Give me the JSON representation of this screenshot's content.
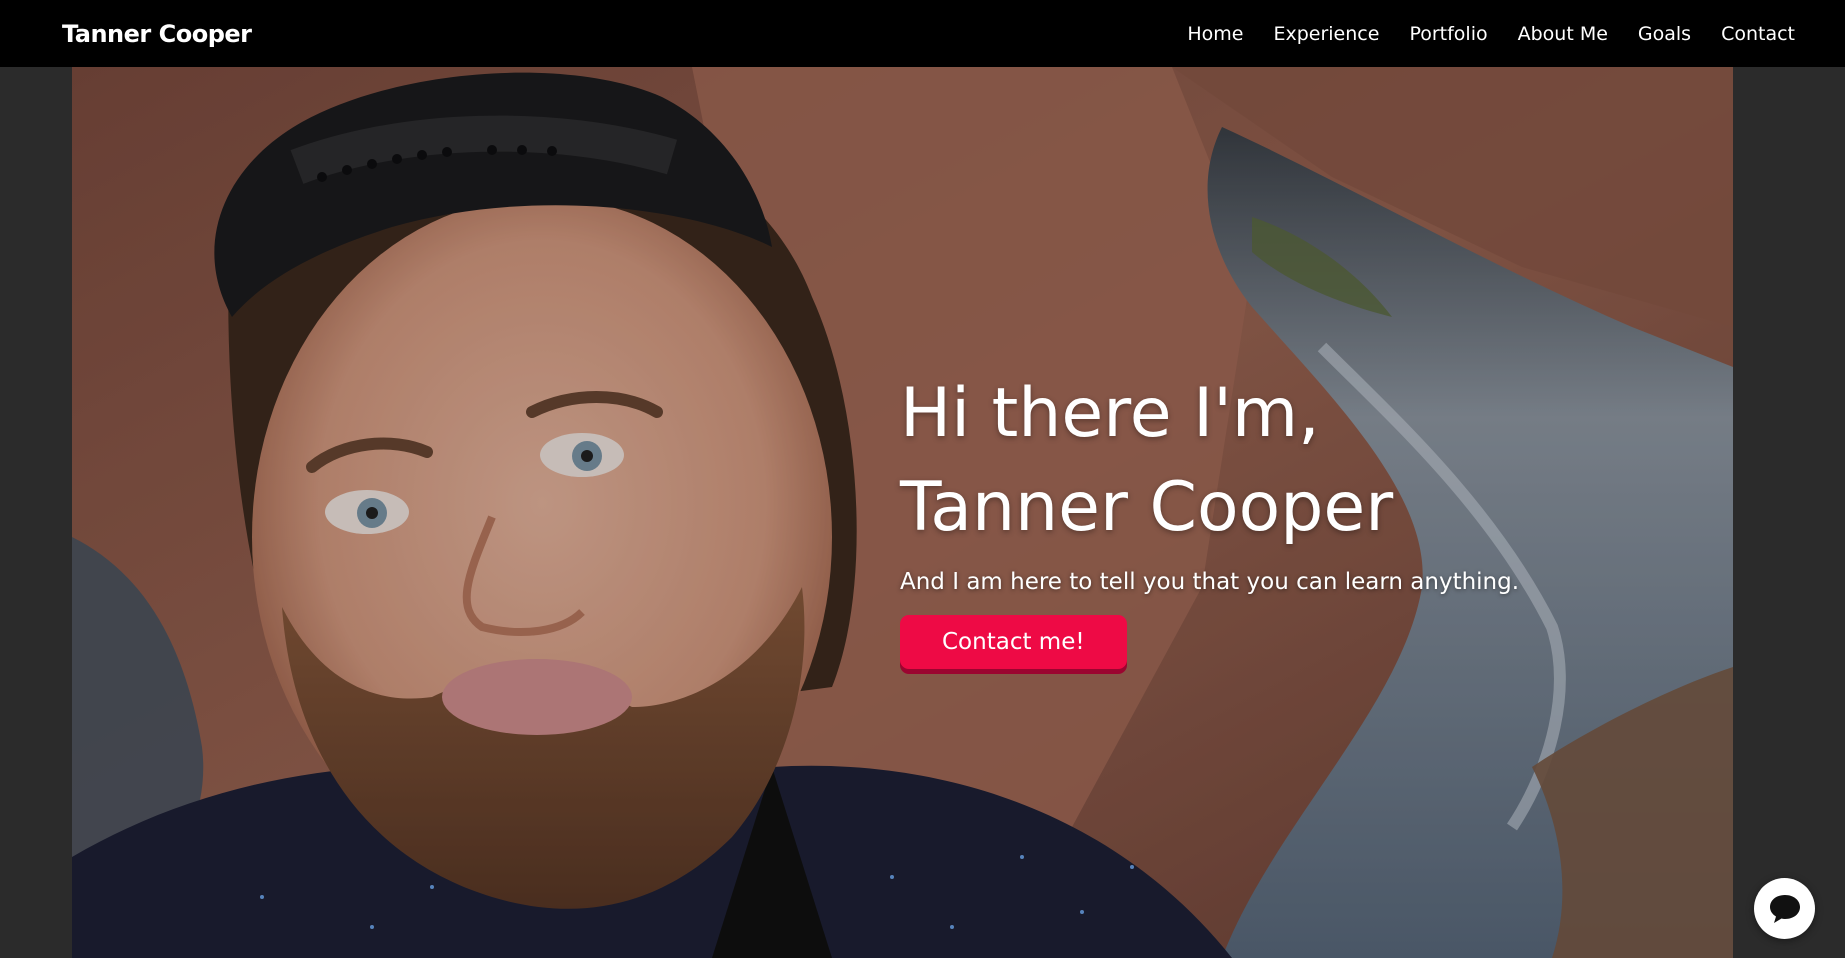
{
  "nav": {
    "brand": "Tanner Cooper",
    "links": [
      "Home",
      "Experience",
      "Portfolio",
      "About Me",
      "Goals",
      "Contact"
    ]
  },
  "hero": {
    "line1": "Hi there I'm,",
    "line2": "Tanner Cooper",
    "subtitle": "And I am here to tell you that you can learn anything.",
    "cta_label": "Contact me!"
  },
  "chat": {
    "icon": "chat-bubble-icon"
  },
  "colors": {
    "nav_bg": "#000000",
    "page_bg": "#2b2b2b",
    "accent": "#ee0a45"
  }
}
